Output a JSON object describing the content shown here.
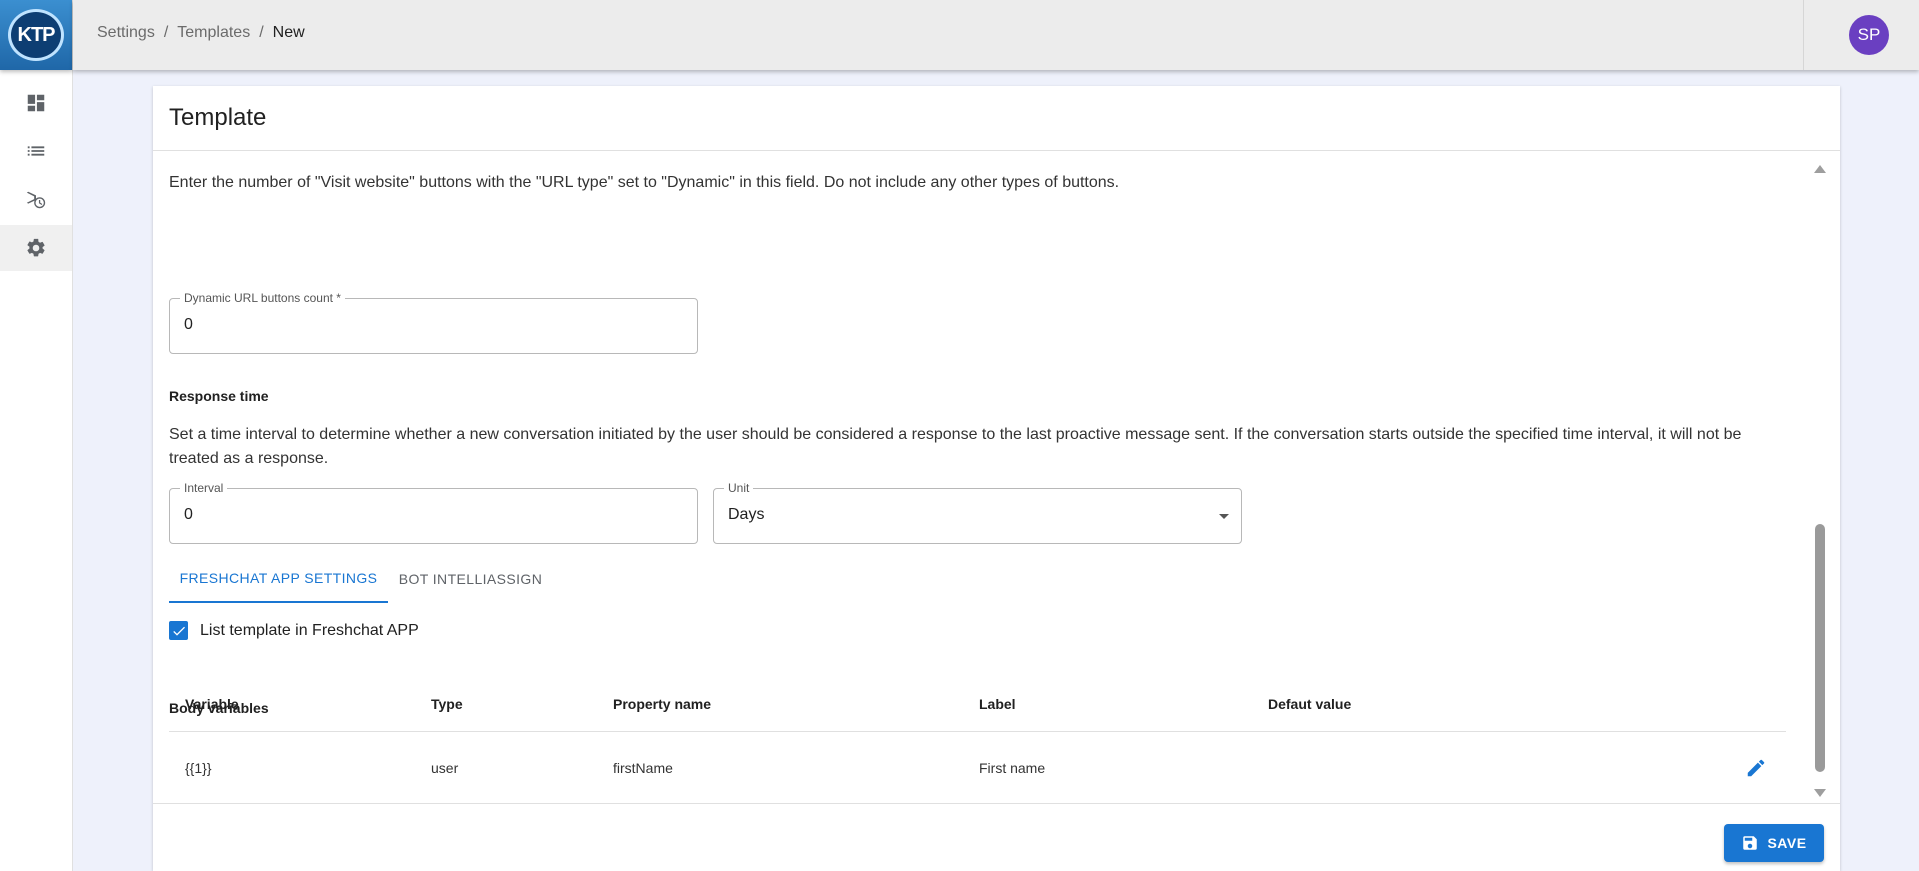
{
  "app": {
    "logo_text": "KTP"
  },
  "sidebar": {
    "items": [
      {
        "name": "dashboard",
        "icon": "dashboard-icon"
      },
      {
        "name": "list",
        "icon": "list-icon"
      },
      {
        "name": "campaign-history",
        "icon": "history-icon"
      },
      {
        "name": "settings",
        "icon": "gear-icon",
        "active": true
      }
    ]
  },
  "header": {
    "breadcrumb": [
      "Settings",
      "Templates",
      "New"
    ],
    "separator": "/",
    "avatar_initials": "SP"
  },
  "card": {
    "title": "Template",
    "dynamic_url": {
      "help": "Enter the number of \"Visit website\" buttons with the \"URL type\" set to \"Dynamic\" in this field. Do not include any other types of buttons.",
      "label": "Dynamic URL buttons count *",
      "value": "0"
    },
    "response_time": {
      "title": "Response time",
      "help": "Set a time interval to determine whether a new conversation initiated by the user should be considered a response to the last proactive message sent. If the conversation starts outside the specified time interval, it will not be treated as a response.",
      "interval_label": "Interval",
      "interval_value": "0",
      "unit_label": "Unit",
      "unit_value": "Days"
    },
    "tabs": [
      {
        "label": "FRESHCHAT APP SETTINGS",
        "active": true
      },
      {
        "label": "BOT INTELLIASSIGN",
        "active": false
      }
    ],
    "list_template": {
      "label": "List template in Freshchat APP",
      "checked": true
    },
    "body_variables": {
      "title": "Body variables",
      "columns": [
        "Variable",
        "Type",
        "Property name",
        "Label",
        "Defaut value"
      ],
      "rows": [
        [
          "{{1}}",
          "user",
          "firstName",
          "First name",
          ""
        ]
      ]
    },
    "save_label": "SAVE"
  },
  "colors": {
    "primary": "#1976d2",
    "avatar": "#6a3fc1"
  }
}
